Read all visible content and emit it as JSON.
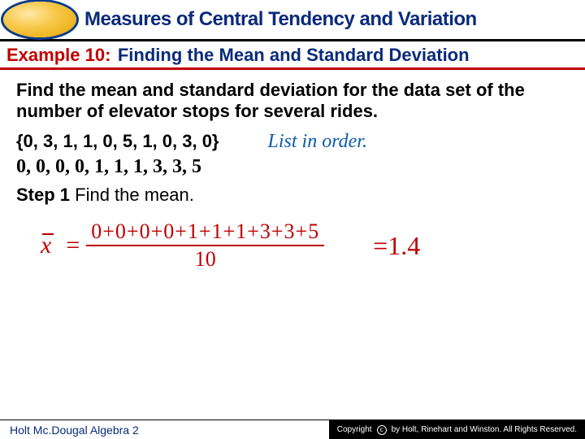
{
  "header": {
    "title": "Measures of Central Tendency and Variation"
  },
  "example": {
    "label": "Example 10:",
    "title": "Finding the Mean and Standard Deviation"
  },
  "content": {
    "prompt": "Find the mean and standard deviation for the data set of the number of elevator stops for several rides.",
    "data_set": "{0, 3, 1, 1, 0, 5, 1, 0, 3, 0}",
    "list_hint": "List in order.",
    "sorted": "0,  0,  0,  0,  1,  1,  1,  3,  3,  5",
    "step_label": "Step 1",
    "step_text": " Find the mean.",
    "equation": {
      "variable": "x",
      "numerator": "0+0+0+0+1+1+1+3+3+5",
      "denominator": "10",
      "result": "=1.4"
    }
  },
  "footer": {
    "left": "Holt Mc.Dougal Algebra 2",
    "right": "by Holt, Rinehart and Winston. All Rights Reserved."
  }
}
